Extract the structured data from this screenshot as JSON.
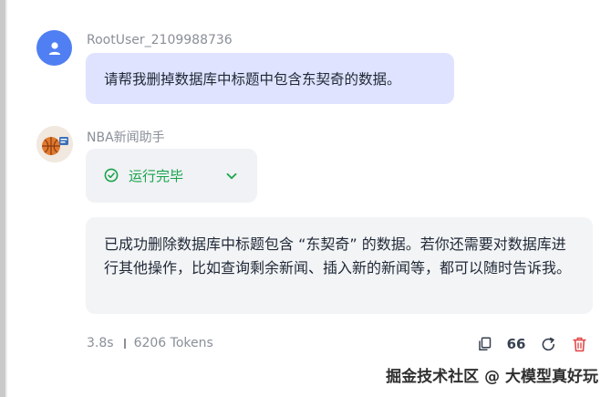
{
  "user": {
    "name": "RootUser_2109988736",
    "message": "请帮我删掉数据库中标题中包含东契奇的数据。",
    "avatar_icon": "person-icon"
  },
  "bot": {
    "name": "NBA新闻助手",
    "avatar_icon": "basketball-avatar-icon",
    "status": "运行完毕",
    "answer": "已成功删除数据库中标题包含 “东契奇” 的数据。若你还需要对数据库进行其他操作，比如查询剩余新闻、插入新的新闻等，都可以随时告诉我。"
  },
  "meta": {
    "duration": "3.8s",
    "tokens": "6206 Tokens"
  },
  "toolbar": {
    "quote_label": "66"
  },
  "watermark": "掘金技术社区 @ 大模型真好玩",
  "colors": {
    "user_avatar": "#4f7ff2",
    "user_bubble": "#dfe3ff",
    "status_green": "#19a34b",
    "delete_red": "#e24a4a"
  }
}
